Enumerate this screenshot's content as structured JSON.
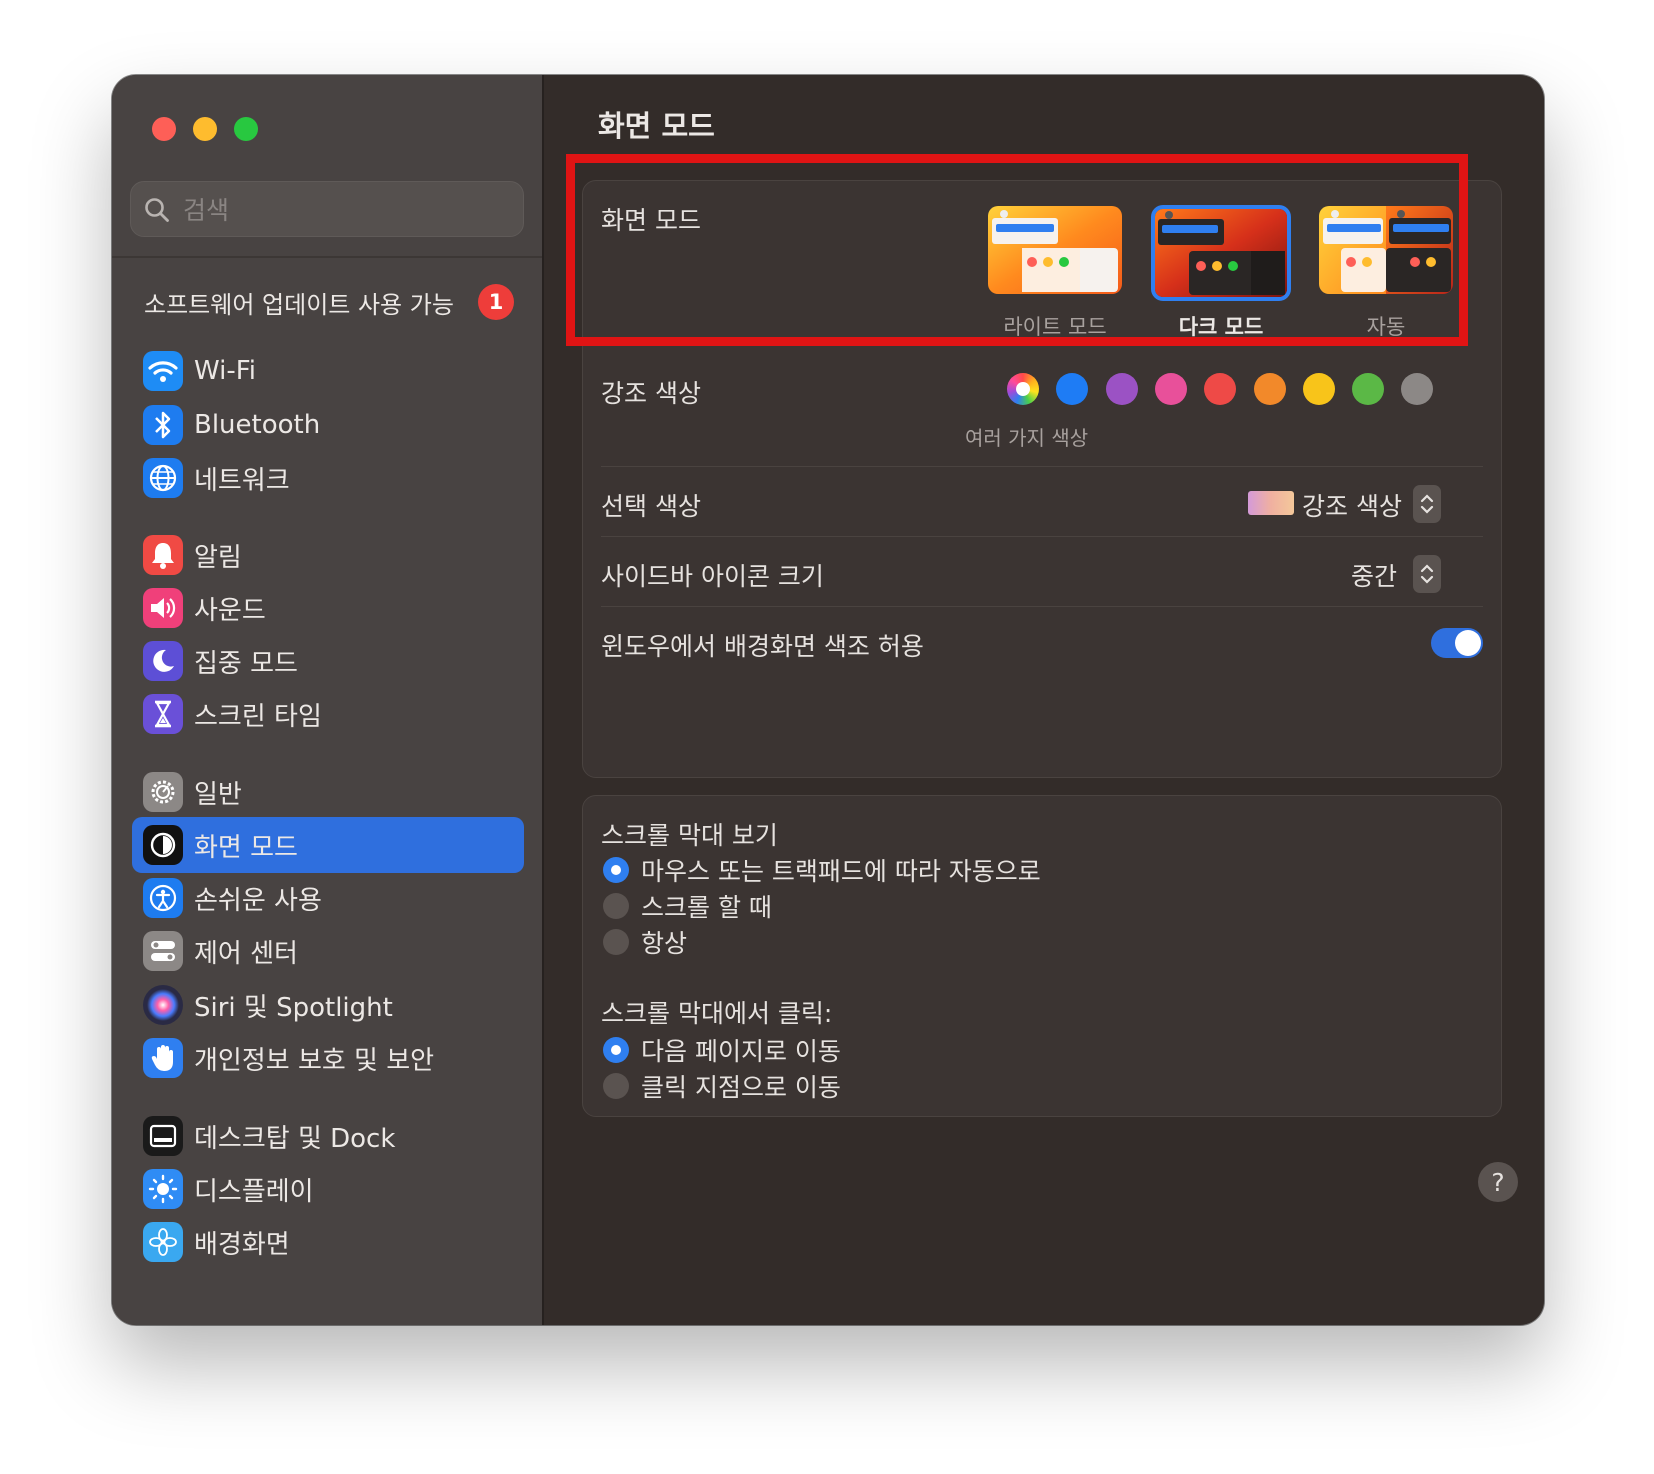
{
  "window": {
    "title": "화면 모드"
  },
  "sidebar": {
    "search_placeholder": "검색",
    "update": {
      "label": "소프트웨어 업데이트 사용 가능",
      "badge": "1"
    },
    "items": [
      {
        "label": "Wi-Fi",
        "icon": "wifi-icon",
        "color": "#1e8cf5"
      },
      {
        "label": "Bluetooth",
        "icon": "bluetooth-icon",
        "color": "#1e7cf0"
      },
      {
        "label": "네트워크",
        "icon": "globe-icon",
        "color": "#1e7cf0"
      },
      {
        "label": "알림",
        "icon": "bell-icon",
        "color": "#f04a44"
      },
      {
        "label": "사운드",
        "icon": "speaker-icon",
        "color": "#f0407a"
      },
      {
        "label": "집중 모드",
        "icon": "moon-icon",
        "color": "#5d4fd6"
      },
      {
        "label": "스크린 타임",
        "icon": "hourglass-icon",
        "color": "#6a50d8"
      },
      {
        "label": "일반",
        "icon": "gear-icon",
        "color": "#8c8886"
      },
      {
        "label": "화면 모드",
        "icon": "appearance-icon",
        "color": "#111111",
        "selected": true
      },
      {
        "label": "손쉬운 사용",
        "icon": "accessibility-icon",
        "color": "#1e7cf0"
      },
      {
        "label": "제어 센터",
        "icon": "control-center-icon",
        "color": "#8c8886"
      },
      {
        "label": "Siri 및 Spotlight",
        "icon": "siri-icon",
        "color": "#2a2a44"
      },
      {
        "label": "개인정보 보호 및 보안",
        "icon": "hand-icon",
        "color": "#2f7ff0"
      },
      {
        "label": "데스크탑 및 Dock",
        "icon": "dock-icon",
        "color": "#1a1a1a"
      },
      {
        "label": "디스플레이",
        "icon": "sun-icon",
        "color": "#2f8cf5"
      },
      {
        "label": "배경화면",
        "icon": "flower-icon",
        "color": "#3aa8f0"
      }
    ]
  },
  "main": {
    "title": "화면 모드",
    "appearance": {
      "label": "화면 모드",
      "options": [
        {
          "label": "라이트 모드",
          "selected": false
        },
        {
          "label": "다크 모드",
          "selected": true
        },
        {
          "label": "자동",
          "selected": false
        }
      ]
    },
    "accent": {
      "label": "강조 색상",
      "caption": "여러 가지 색상",
      "colors": [
        "multicolor",
        "#1e7cf5",
        "#9b52c4",
        "#e8509a",
        "#ee4a47",
        "#f2892a",
        "#f8c41a",
        "#5bb846",
        "#8c8886"
      ]
    },
    "highlight": {
      "label": "선택 색상",
      "value": "강조 색상"
    },
    "sidebar_icon_size": {
      "label": "사이드바 아이콘 크기",
      "value": "중간"
    },
    "wallpaper_tinting": {
      "label": "윈도우에서 배경화면 색조 허용",
      "enabled": true
    },
    "scrollbars": {
      "show_label": "스크롤 막대 보기",
      "show_options": [
        {
          "label": "마우스 또는 트랙패드에 따라 자동으로",
          "selected": true
        },
        {
          "label": "스크롤 할 때",
          "selected": false
        },
        {
          "label": "항상",
          "selected": false
        }
      ],
      "click_label": "스크롤 막대에서 클릭:",
      "click_options": [
        {
          "label": "다음 페이지로 이동",
          "selected": true
        },
        {
          "label": "클릭 지점으로 이동",
          "selected": false
        }
      ]
    },
    "help": "?"
  },
  "colors": {
    "accent_blue": "#2f6fde",
    "highlight_red": "#e01414",
    "window_bg": "#332c29",
    "sidebar_bg": "#484342"
  }
}
